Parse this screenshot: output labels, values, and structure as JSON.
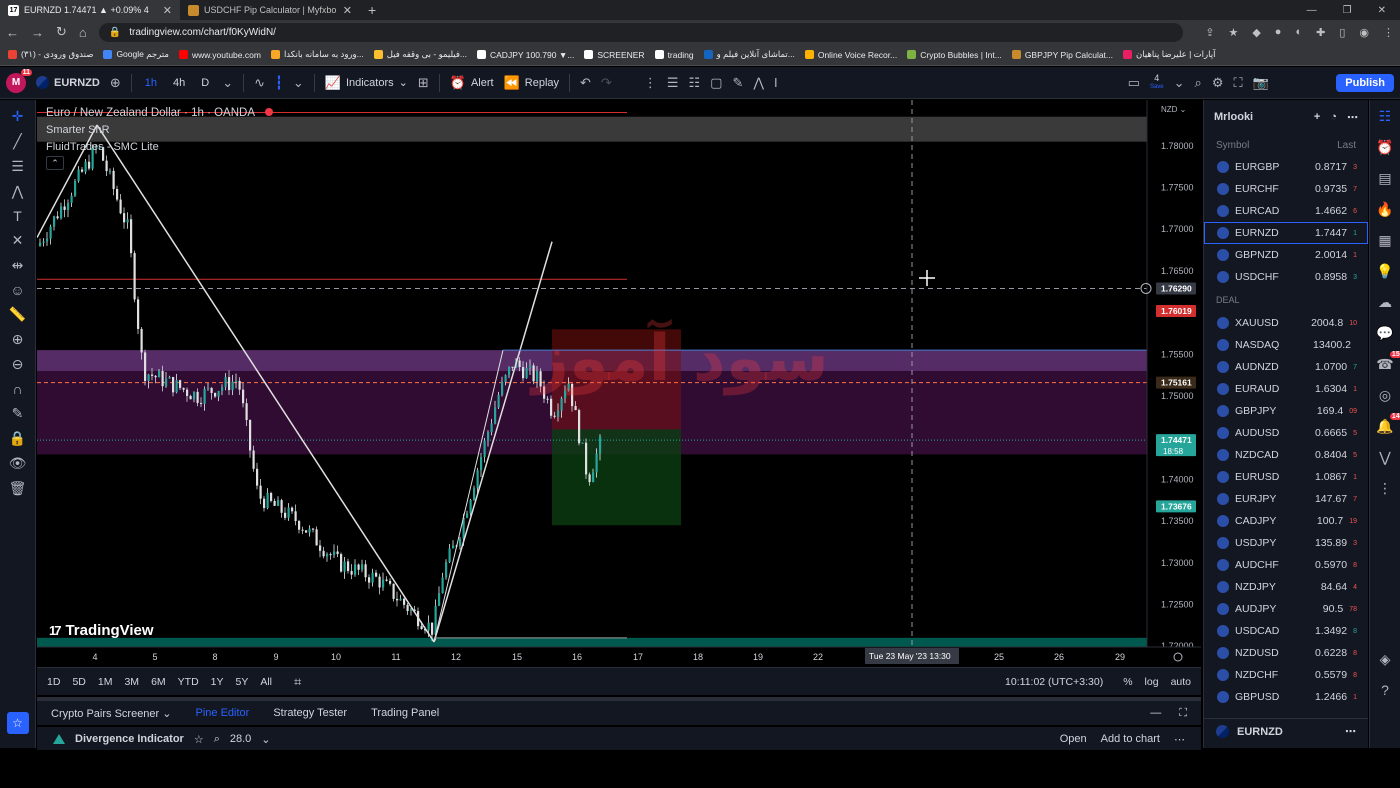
{
  "browser": {
    "tabs": [
      {
        "title": "EURNZD 1.74471 ▲ +0.09% 4"
      },
      {
        "title": "USDCHF Pip Calculator | Myfxbo"
      }
    ],
    "url": "tradingview.com/chart/f0KyWidN/",
    "bookmarks": [
      "صندوق ورودی - (۳۱)",
      "Google مترجم",
      "www.youtube.com",
      "ورود به سامانه بانکدا...",
      "فیلیمو - بی وقفه فیل...",
      "CADJPY 100.790 ▼...",
      "SCREENER",
      "trading",
      "تماشای آنلاین فیلم و...",
      "Online Voice Recor...",
      "Crypto Bubbles | Int...",
      "GBPJPY Pip Calculat...",
      "آپارات | علیرضا پناهیان"
    ]
  },
  "toolbar": {
    "avatar": "M",
    "avatar_badge": "11",
    "symbol": "EURNZD",
    "timeframes": [
      "1h",
      "4h",
      "D"
    ],
    "indicators": "Indicators",
    "alert": "Alert",
    "replay": "Replay",
    "save_count": "4",
    "save_label": "Save",
    "publish": "Publish"
  },
  "chart": {
    "title": "Euro / New Zealand Dollar · 1h · OANDA",
    "indicators": [
      "Smarter SnR",
      "FluidTrades - SMC Lite"
    ],
    "currency": "NZD",
    "brand": "TradingView",
    "watermark": "سود آموز",
    "crosshair_time": "Tue 23 May '23",
    "crosshair_clock": "13:30",
    "price_ticks": [
      "1.78000",
      "1.77500",
      "1.77000",
      "1.76500",
      "1.75500",
      "1.75000",
      "1.74000",
      "1.73500",
      "1.73000",
      "1.72500",
      "1.72000"
    ],
    "price_tags": [
      {
        "value": "1.76290",
        "kind": "crosshair"
      },
      {
        "value": "1.76019",
        "kind": "red"
      },
      {
        "value": "1.75161",
        "kind": "orange"
      },
      {
        "value": "1.74471",
        "sub": "18:58",
        "kind": "green"
      },
      {
        "value": "1.73676",
        "kind": "green"
      }
    ],
    "x_ticks": [
      "4",
      "5",
      "8",
      "9",
      "10",
      "11",
      "12",
      "15",
      "16",
      "17",
      "18",
      "19",
      "22",
      "25",
      "26",
      "29"
    ],
    "colors": {
      "bull": "#26a69a",
      "bear": "#ef5350",
      "supply_zone": "#6a1b6e",
      "demand_zone": "#00695c"
    }
  },
  "chart_data": {
    "type": "candlestick",
    "title": "Euro / New Zealand Dollar · 1h · OANDA",
    "xlabel": "",
    "ylabel": "",
    "ylim": [
      1.7175,
      1.7855
    ],
    "x": [
      "4",
      "5",
      "8",
      "9",
      "10",
      "11",
      "12",
      "15",
      "16"
    ],
    "close": [
      1.768,
      1.752,
      1.7445,
      1.735,
      1.729,
      1.722,
      1.733,
      1.7525,
      1.7447
    ],
    "high": [
      1.7825,
      1.7565,
      1.752,
      1.742,
      1.735,
      1.728,
      1.742,
      1.7555,
      1.7535
    ],
    "low": [
      1.764,
      1.747,
      1.739,
      1.731,
      1.724,
      1.72,
      1.722,
      1.742,
      1.7385
    ],
    "last_price": 1.74471
  },
  "range": {
    "items": [
      "1D",
      "5D",
      "1M",
      "3M",
      "6M",
      "YTD",
      "1Y",
      "5Y",
      "All"
    ],
    "clock": "10:11:02 (UTC+3:30)",
    "options": [
      "%",
      "log",
      "auto"
    ]
  },
  "panels": {
    "tabs": [
      "Crypto Pairs Screener",
      "Pine Editor",
      "Strategy Tester",
      "Trading Panel"
    ],
    "selected": "Pine Editor",
    "script": {
      "name": "Divergence Indicator",
      "version": "28.0",
      "open": "Open",
      "add": "Add to chart"
    }
  },
  "watchlist": {
    "name": "Mrlooki",
    "col_symbol": "Symbol",
    "col_last": "Last",
    "section": "DEAL",
    "group1": [
      {
        "s": "EURGBP",
        "p": "0.8717",
        "f": "3",
        "c": "#ef5350"
      },
      {
        "s": "EURCHF",
        "p": "0.9735",
        "f": "7",
        "c": "#ef5350"
      },
      {
        "s": "EURCAD",
        "p": "1.4662",
        "f": "6",
        "c": "#ef5350"
      },
      {
        "s": "EURNZD",
        "p": "1.7447",
        "f": "1",
        "c": "#26a69a",
        "sel": true
      },
      {
        "s": "GBPNZD",
        "p": "2.0014",
        "f": "1",
        "c": "#ef5350"
      },
      {
        "s": "USDCHF",
        "p": "0.8958",
        "f": "3",
        "c": "#26a69a"
      }
    ],
    "group2": [
      {
        "s": "XAUUSD",
        "p": "2004.8",
        "f": "10",
        "c": "#ef5350"
      },
      {
        "s": "NASDAQ",
        "p": "13400.2",
        "f": "",
        "c": "#26a69a"
      },
      {
        "s": "AUDNZD",
        "p": "1.0700",
        "f": "7",
        "c": "#26a69a"
      },
      {
        "s": "EURAUD",
        "p": "1.6304",
        "f": "1",
        "c": "#ef5350"
      },
      {
        "s": "GBPJPY",
        "p": "169.4",
        "f": "09",
        "c": "#ef5350"
      },
      {
        "s": "AUDUSD",
        "p": "0.6665",
        "f": "5",
        "c": "#ef5350"
      },
      {
        "s": "NZDCAD",
        "p": "0.8404",
        "f": "5",
        "c": "#ef5350"
      },
      {
        "s": "EURUSD",
        "p": "1.0867",
        "f": "1",
        "c": "#ef5350"
      },
      {
        "s": "EURJPY",
        "p": "147.67",
        "f": "7",
        "c": "#ef5350"
      },
      {
        "s": "CADJPY",
        "p": "100.7",
        "f": "19",
        "c": "#ef5350"
      },
      {
        "s": "USDJPY",
        "p": "135.89",
        "f": "3",
        "c": "#ef5350"
      },
      {
        "s": "AUDCHF",
        "p": "0.5970",
        "f": "8",
        "c": "#ef5350"
      },
      {
        "s": "NZDJPY",
        "p": "84.64",
        "f": "4",
        "c": "#ef5350"
      },
      {
        "s": "AUDJPY",
        "p": "90.5",
        "f": "78",
        "c": "#ef5350"
      },
      {
        "s": "USDCAD",
        "p": "1.3492",
        "f": "8",
        "c": "#26a69a"
      },
      {
        "s": "NZDUSD",
        "p": "0.6228",
        "f": "8",
        "c": "#ef5350"
      },
      {
        "s": "NZDCHF",
        "p": "0.5579",
        "f": "8",
        "c": "#ef5350"
      },
      {
        "s": "GBPUSD",
        "p": "1.2466",
        "f": "1",
        "c": "#ef5350"
      }
    ],
    "footer": "EURNZD"
  },
  "rightbar": {
    "badge1": "15",
    "badge2": "14"
  }
}
